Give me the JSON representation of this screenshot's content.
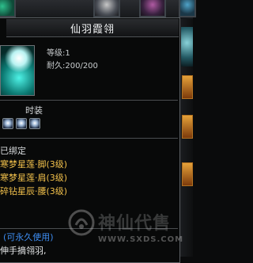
{
  "item": {
    "title": "仙羽霞翎",
    "level": "等级:1",
    "durability": "耐久:200/200",
    "fashion_label": "时装",
    "gem_icons": [
      "gem-icon",
      "gem-icon",
      "gem-icon"
    ],
    "bound": "已绑定",
    "set_items": [
      "寒梦星莲·脚(3级)",
      "寒梦星莲·肩(3级)",
      "碎钻星辰·腰(3级)"
    ],
    "permanent": "(可永久使用)",
    "description": "伸手摘翎羽,"
  },
  "watermark": {
    "text": "神仙代售",
    "url": "WWW.SXDS.COM"
  },
  "colors": {
    "set_item": "#f1c04b",
    "permanent": "#3d8cf0",
    "title": "#f1f3f4"
  }
}
